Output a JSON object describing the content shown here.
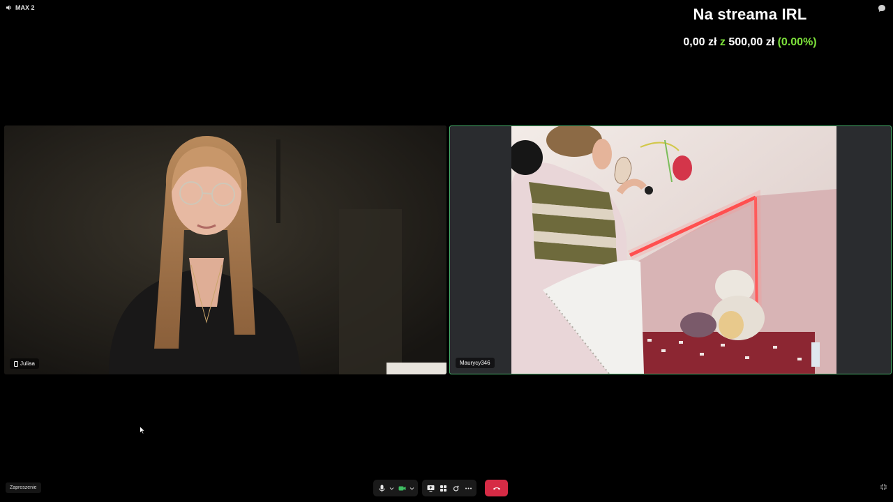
{
  "channel": {
    "label": "MAX 2",
    "icon": "speaker-icon"
  },
  "goal": {
    "title": "Na streama IRL",
    "current": "0,00 zł",
    "separator": "z",
    "target": "500,00 zł",
    "percent": "(0.00%)",
    "progress_fraction": 0.0,
    "accent_color": "#7ee33b"
  },
  "participants": [
    {
      "name": "Juliaa",
      "device_icon": "phone-icon"
    },
    {
      "name": "Maurycy346",
      "active_speaker": true,
      "highlight_color": "#49b36d"
    }
  ],
  "invite_label": "Zaproszenie",
  "controls": {
    "icons": [
      "microphone-icon",
      "chevron-down-icon",
      "camera-icon",
      "chevron-down-icon",
      "screen-share-icon",
      "grid-icon",
      "effects-icon",
      "more-icon",
      "hang-up-icon"
    ],
    "hangup_color": "#d62b45"
  }
}
